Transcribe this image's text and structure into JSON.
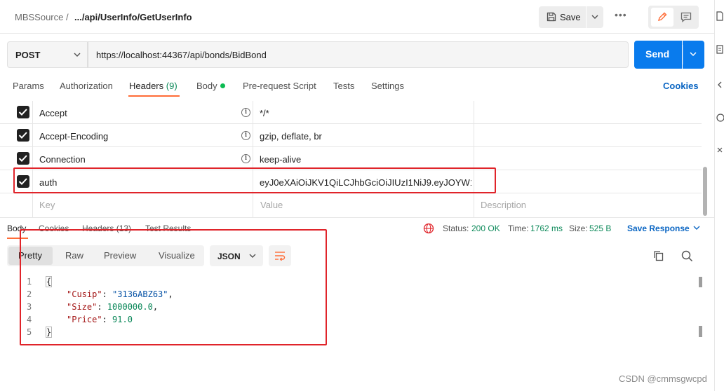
{
  "breadcrumb": {
    "workspace": "MBSSource",
    "separator": "/",
    "request": ".../api/UserInfo/GetUserInfo"
  },
  "toolbar": {
    "save_label": "Save",
    "more_label": "•••"
  },
  "request": {
    "method": "POST",
    "url": "https://localhost:44367/api/bonds/BidBond",
    "send_label": "Send"
  },
  "tabs": {
    "params": "Params",
    "authorization": "Authorization",
    "headers": "Headers",
    "headers_count": "(9)",
    "body": "Body",
    "pre_request": "Pre-request Script",
    "tests": "Tests",
    "settings": "Settings",
    "cookies": "Cookies"
  },
  "headers": {
    "rows": [
      {
        "key": "Accept",
        "value": "*/*",
        "checked": true
      },
      {
        "key": "Accept-Encoding",
        "value": "gzip, deflate, br",
        "checked": true
      },
      {
        "key": "Connection",
        "value": "keep-alive",
        "checked": true
      },
      {
        "key": "auth",
        "value": "eyJ0eXAiOiJKV1QiLCJhbGciOiJIUzI1NiJ9.eyJOYW1l...",
        "checked": true
      }
    ],
    "placeholder": {
      "key": "Key",
      "value": "Value",
      "description": "Description"
    }
  },
  "response": {
    "tabs": {
      "body": "Body",
      "cookies": "Cookies",
      "headers": "Headers (13)",
      "test_results": "Test Results"
    },
    "status_label": "Status:",
    "status_value": "200 OK",
    "time_label": "Time:",
    "time_value": "1762 ms",
    "size_label": "Size:",
    "size_value": "525 B",
    "save_response": "Save Response",
    "formats": [
      "Pretty",
      "Raw",
      "Preview",
      "Visualize"
    ],
    "language": "JSON",
    "code": {
      "line_numbers": [
        "1",
        "2",
        "3",
        "4",
        "5"
      ],
      "open": "{",
      "close": "}",
      "fields": [
        {
          "key": "\"Cusip\"",
          "colon": ": ",
          "value": "\"3136ABZ63\"",
          "comma": ",",
          "kind": "str"
        },
        {
          "key": "\"Size\"",
          "colon": ": ",
          "value": "1000000.0",
          "comma": ",",
          "kind": "num"
        },
        {
          "key": "\"Price\"",
          "colon": ": ",
          "value": "91.0",
          "comma": "",
          "kind": "num"
        }
      ]
    }
  },
  "watermark": "CSDN @cmmsgwcpd",
  "colors": {
    "accent": "#ff6c37",
    "send": "#097bed",
    "link": "#0b66c3",
    "annotation": "#e0242a"
  }
}
